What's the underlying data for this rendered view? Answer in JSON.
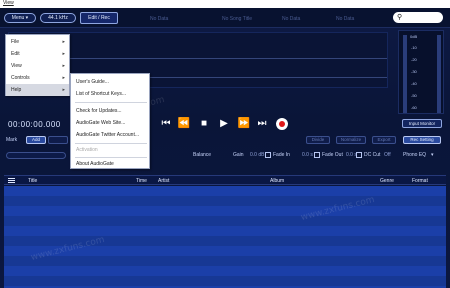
{
  "titlebar": {
    "view_menu": "View"
  },
  "toolbar": {
    "menu_label": "Menu",
    "sample_rate": "44.1 kHz",
    "mode_label": "Edit / Rec",
    "ghost_labels": [
      "No Data",
      "No Song Title",
      "No Data",
      "No Data"
    ],
    "search_placeholder": ""
  },
  "meters": {
    "top_label": "0dB",
    "ticks": [
      "-10",
      "-20",
      "-30",
      "-40",
      "-50",
      "-60"
    ],
    "input_monitor": "Input Monitor"
  },
  "transport": {
    "time": "00:00:00.000"
  },
  "mark_row": {
    "mark_label": "Mark",
    "add_label": "Add",
    "right_buttons": [
      "Divide",
      "Normalize",
      "Export",
      "Rec Setting"
    ]
  },
  "fx_row": {
    "balance": "Balance",
    "gain": "Gain",
    "gain_value": "0.0 dB",
    "fade_in": "Fade In",
    "fade_in_value": "0.0 s",
    "fade_out": "Fade Out",
    "fade_out_value": "0.0 s",
    "dc_cut": "DC Cut",
    "dc_cut_value": "Off",
    "phono_eq": "Phono EQ"
  },
  "table": {
    "columns": [
      "Title",
      "Time",
      "Artist",
      "Album",
      "Genre",
      "Format"
    ]
  },
  "main_menu": {
    "items": [
      {
        "label": "File"
      },
      {
        "label": "Edit"
      },
      {
        "label": "View"
      },
      {
        "label": "Controls"
      },
      {
        "label": "Help"
      }
    ]
  },
  "help_menu": {
    "items": [
      {
        "label": "User's Guide..."
      },
      {
        "label": "List of Shortcut Keys..."
      },
      {
        "label": "Check for Updates..."
      },
      {
        "label": "AudioGate Web Site..."
      },
      {
        "label": "AudioGate Twitter Account..."
      },
      {
        "label": "Activation"
      },
      {
        "label": "About AudioGate"
      }
    ]
  },
  "watermark": "www.zxfuns.com",
  "colors": {
    "background": "#0b1740",
    "list_stripe": "#1b3fa8",
    "record": "#e01818"
  },
  "icons": [
    "search-icon",
    "skip-start-icon",
    "rewind-icon",
    "stop-icon",
    "play-icon",
    "fast-forward-icon",
    "skip-end-icon",
    "record-icon",
    "list-icon"
  ]
}
